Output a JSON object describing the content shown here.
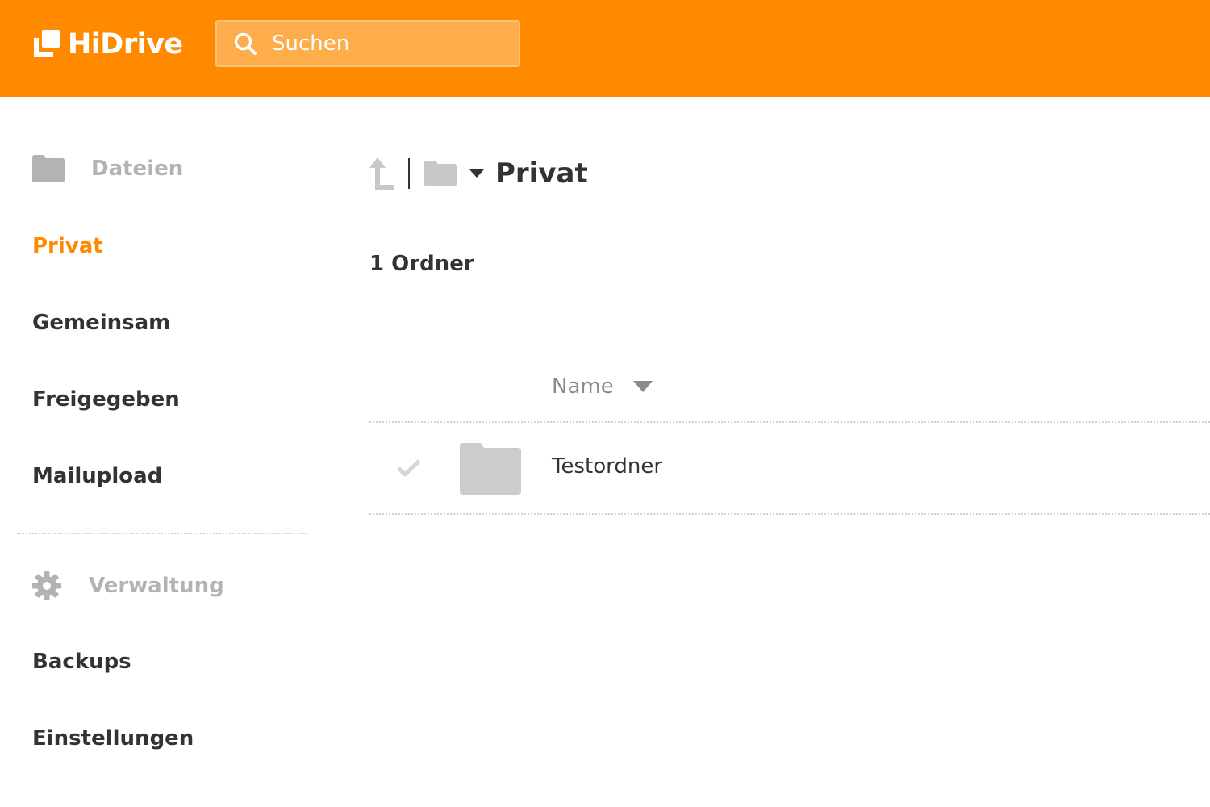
{
  "header": {
    "brand": "HiDrive",
    "search": {
      "placeholder": "Suchen",
      "value": ""
    },
    "background_color": "#ff8a00"
  },
  "sidebar": {
    "files_section": {
      "label": "Dateien",
      "icon": "folder-icon"
    },
    "items": [
      {
        "label": "Privat",
        "active": true
      },
      {
        "label": "Gemeinsam",
        "active": false
      },
      {
        "label": "Freigegeben",
        "active": false
      },
      {
        "label": "Mailupload",
        "active": false
      }
    ],
    "admin_section": {
      "label": "Verwaltung",
      "icon": "gear-icon"
    },
    "admin_items": [
      {
        "label": "Backups"
      },
      {
        "label": "Einstellungen"
      }
    ],
    "active_color": "#ff8a00"
  },
  "main": {
    "breadcrumb": {
      "up_icon": "arrow-up-icon",
      "folder_icon": "folder-icon",
      "dropdown_icon": "caret-down-icon",
      "current": "Privat"
    },
    "summary": "1 Ordner",
    "table": {
      "columns": [
        {
          "label": "Name",
          "sort": "descending"
        }
      ],
      "rows": [
        {
          "name": "Testordner",
          "type": "folder",
          "selected": false
        }
      ]
    }
  }
}
